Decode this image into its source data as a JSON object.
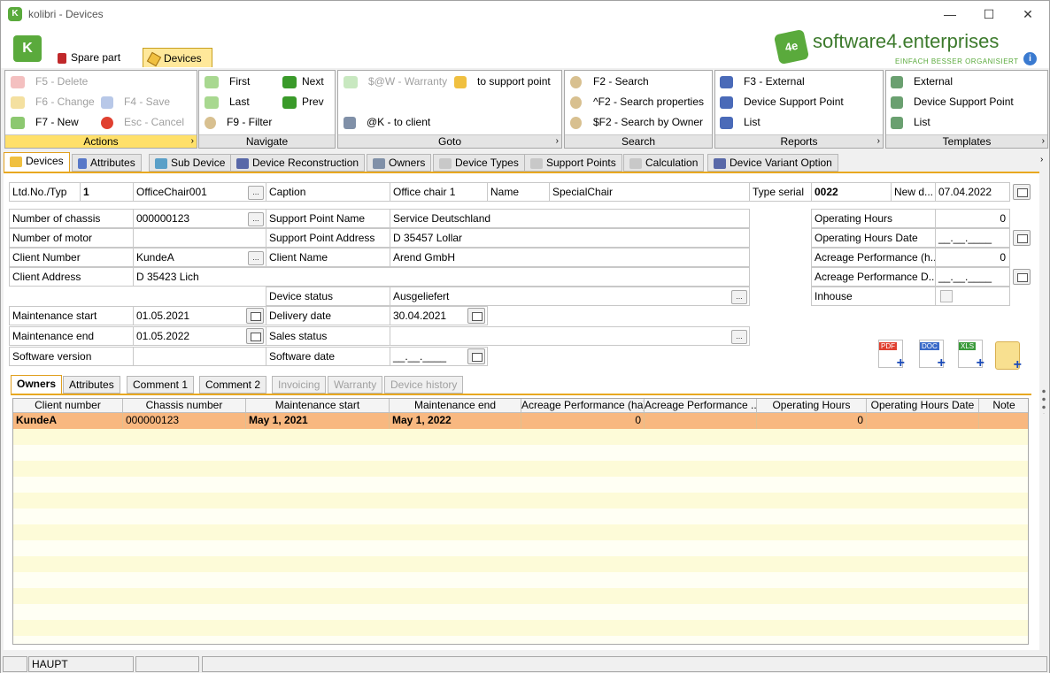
{
  "window": {
    "title": "kolibri - Devices",
    "minimize": "—",
    "maximize": "☐",
    "close": "✕"
  },
  "brand": {
    "name": "software4.enterprises",
    "slogan": "EINFACH BESSER ORGANISIERT",
    "logo_text": "4e"
  },
  "ribbon_tabs": [
    {
      "label": "Spare part"
    },
    {
      "label": "Devices"
    }
  ],
  "ribbon": {
    "actions": {
      "label": "Actions",
      "delete": "F5 - Delete",
      "change": "F6 - Change",
      "new": "F7 - New",
      "save": "F4 - Save",
      "cancel": "Esc - Cancel"
    },
    "navigate": {
      "label": "Navigate",
      "first": "First",
      "next": "Next",
      "last": "Last",
      "prev": "Prev",
      "filter": "F9 - Filter"
    },
    "goto": {
      "label": "Goto",
      "warranty": "$@W - Warranty",
      "support": "to support point",
      "client": "@K - to client"
    },
    "search": {
      "label": "Search",
      "search": "F2 - Search",
      "props": "^F2 - Search properties",
      "owner": "$F2 - Search by Owner"
    },
    "reports": {
      "label": "Reports",
      "external": "F3 - External",
      "dsp": "Device Support Point",
      "list": "List"
    },
    "templates": {
      "label": "Templates",
      "external": "External",
      "dsp": "Device Support Point",
      "list": "List"
    }
  },
  "tabs": [
    "Devices",
    "Attributes",
    "Sub Device",
    "Device Reconstruction",
    "Owners",
    "Device Types",
    "Support Points",
    "Calculation",
    "Device Variant Option"
  ],
  "form": {
    "ltd_label": "Ltd.No./Typ",
    "ltd_no": "1",
    "typ": "OfficeChair001",
    "caption_label": "Caption",
    "caption": "Office chair 1",
    "name_label": "Name",
    "name": "SpecialChair",
    "type_serial_label": "Type serial",
    "type_serial": "0022",
    "new_d_label": "New d...",
    "new_d": "07.04.2022",
    "chassis_label": "Number of chassis",
    "chassis": "000000123",
    "sp_name_label": "Support Point Name",
    "sp_name": "Service Deutschland",
    "op_hours_label": "Operating Hours",
    "op_hours": "0",
    "motor_label": "Number of motor",
    "motor": "",
    "sp_addr_label": "Support Point Address",
    "sp_addr": "D 35457 Lollar",
    "op_hours_date_label": "Operating Hours Date",
    "op_hours_date": "__.__.____",
    "client_no_label": "Client Number",
    "client_no": "KundeA",
    "client_name_label": "Client Name",
    "client_name": "Arend GmbH",
    "acreage_label": "Acreage Performance (h...",
    "acreage": "0",
    "client_addr_label": "Client Address",
    "client_addr": "D 35423 Lich",
    "acreage_d_label": "Acreage Performance D...",
    "acreage_d": "__.__.____",
    "status_label": "Device status",
    "status": "Ausgeliefert",
    "inhouse_label": "Inhouse",
    "maint_start_label": "Maintenance start",
    "maint_start": "01.05.2021",
    "delivery_label": "Delivery date",
    "delivery": "30.04.2021",
    "maint_end_label": "Maintenance end",
    "maint_end": "01.05.2022",
    "sales_label": "Sales status",
    "sales": "",
    "sw_version_label": "Software version",
    "sw_version": "",
    "sw_date_label": "Software date",
    "sw_date": "__.__.____",
    "dots": "..."
  },
  "export_icons": {
    "pdf": "PDF",
    "doc": "DOC",
    "xls": "XLS"
  },
  "subtabs": [
    "Owners",
    "Attributes",
    "Comment 1",
    "Comment 2",
    "Invoicing",
    "Warranty",
    "Device history"
  ],
  "grid": {
    "columns": [
      "Client number",
      "Chassis number",
      "Maintenance start",
      "Maintenance end",
      "Acreage Performance (ha)",
      "Acreage Performance ...",
      "Operating Hours",
      "Operating Hours Date",
      "Note"
    ],
    "rows": [
      [
        "KundeA",
        "000000123",
        "May 1, 2021",
        "May 1, 2022",
        "0",
        "",
        "0",
        "",
        ""
      ]
    ]
  },
  "statusbar": {
    "s1": "",
    "s2": "HAUPT",
    "s3": "",
    "s4": ""
  }
}
